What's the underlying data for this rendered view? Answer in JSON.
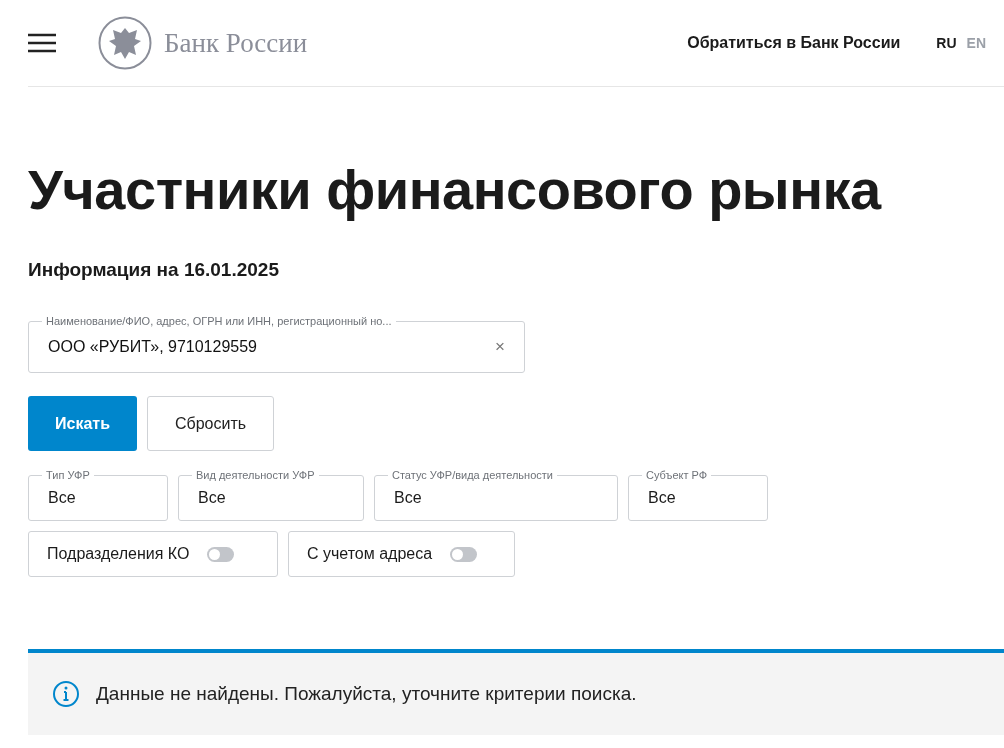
{
  "header": {
    "logo_text": "Банк России",
    "contact_link": "Обратиться в Банк России",
    "languages": [
      {
        "label": "RU",
        "selected": true
      },
      {
        "label": "EN",
        "selected": false
      }
    ]
  },
  "title": "Участники финансового рынка",
  "info_date": "Информация на 16.01.2025",
  "search": {
    "label": "Наименование/ФИО, адрес, ОГРН или ИНН, регистрационный но...",
    "value": "ООО «РУБИТ», 9710129559",
    "clear": "×"
  },
  "buttons": [
    {
      "label": "Искать",
      "kind": "primary"
    },
    {
      "label": "Сбросить",
      "kind": "secondary"
    }
  ],
  "filters": [
    {
      "label": "Тип УФР",
      "value": "Все"
    },
    {
      "label": "Вид деятельности УФР",
      "value": "Все"
    },
    {
      "label": "Статус УФР/вида деятельности",
      "value": "Все"
    },
    {
      "label": "Субъект РФ",
      "value": "Все"
    }
  ],
  "toggles": [
    {
      "label": "Подразделения КО",
      "on": false
    },
    {
      "label": "С учетом адреса",
      "on": false
    }
  ],
  "alert": {
    "message": "Данные не найдены. Пожалуйста, уточните критерии поиска."
  }
}
